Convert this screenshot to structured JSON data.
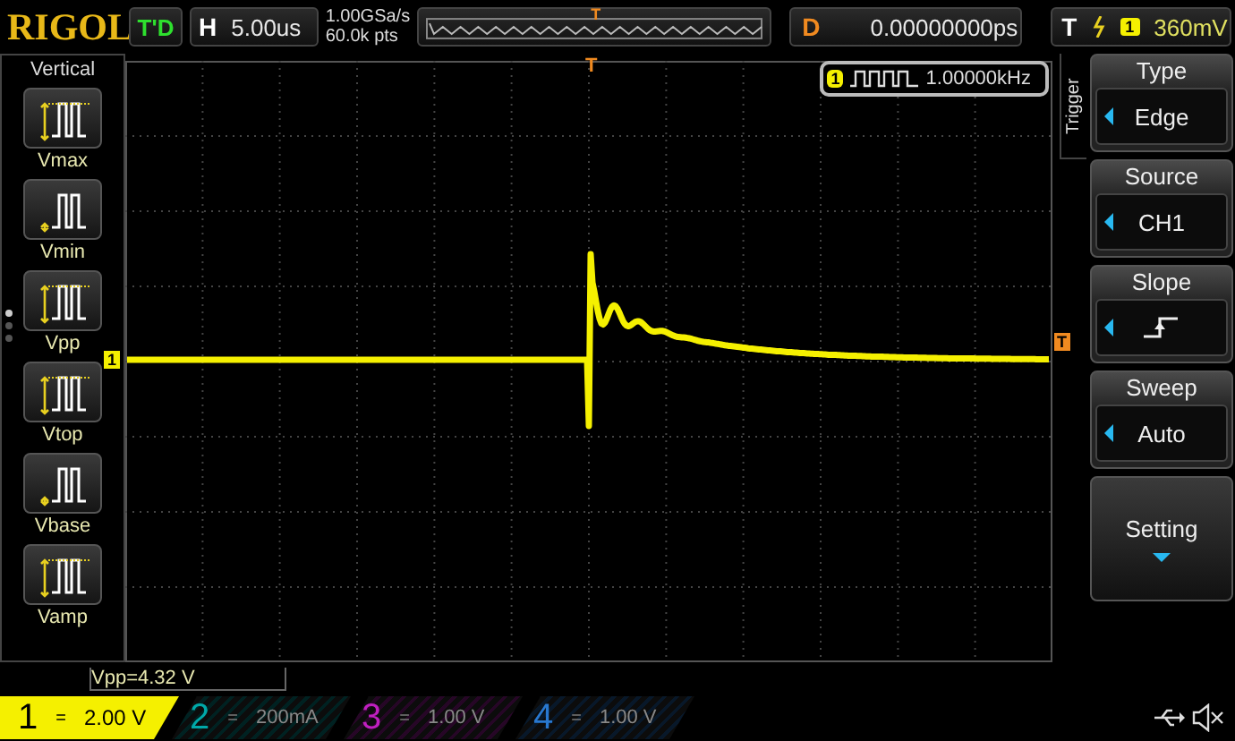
{
  "header": {
    "logo": "RIGOL",
    "run_state": "T'D",
    "timebase_label": "H",
    "timebase": "5.00us",
    "sample_rate": "1.00GSa/s",
    "memory_depth": "60.0k pts",
    "position_marker": "T",
    "delay_label": "D",
    "delay": "0.00000000ps",
    "trigger_label": "T",
    "trigger_channel": "1",
    "trigger_level": "360mV"
  },
  "left_menu": {
    "title": "Vertical",
    "items": [
      {
        "label": "Vmax",
        "kind": "max"
      },
      {
        "label": "Vmin",
        "kind": "min"
      },
      {
        "label": "Vpp",
        "kind": "pp"
      },
      {
        "label": "Vtop",
        "kind": "top"
      },
      {
        "label": "Vbase",
        "kind": "base"
      },
      {
        "label": "Vamp",
        "kind": "amp"
      }
    ],
    "pages": [
      {
        "selected": true
      },
      {
        "selected": false
      },
      {
        "selected": false
      }
    ]
  },
  "display": {
    "trigger_marker": "T",
    "channel_marker": "1",
    "level_marker": "T",
    "frequency_channel": "1",
    "frequency": "1.00000kHz",
    "measurement": "Vpp=4.32 V"
  },
  "right_menu": {
    "tab": "Trigger",
    "items": [
      {
        "title": "Type",
        "kind": "text",
        "value": "Edge"
      },
      {
        "title": "Source",
        "kind": "text",
        "value": "CH1"
      },
      {
        "title": "Slope",
        "kind": "rising-edge"
      },
      {
        "title": "Sweep",
        "kind": "text",
        "value": "Auto"
      }
    ],
    "setting": "Setting"
  },
  "channels": [
    {
      "number": "1",
      "coupling": "=",
      "scale": "2.00 V",
      "selected": true,
      "color": "#f5f000"
    },
    {
      "number": "2",
      "coupling": "=",
      "scale": "200mA",
      "selected": false,
      "color": "#00a8a8"
    },
    {
      "number": "3",
      "coupling": "=",
      "scale": "1.00 V",
      "selected": false,
      "color": "#c020c0"
    },
    {
      "number": "4",
      "coupling": "=",
      "scale": "1.00 V",
      "selected": false,
      "color": "#2878d0"
    }
  ]
}
